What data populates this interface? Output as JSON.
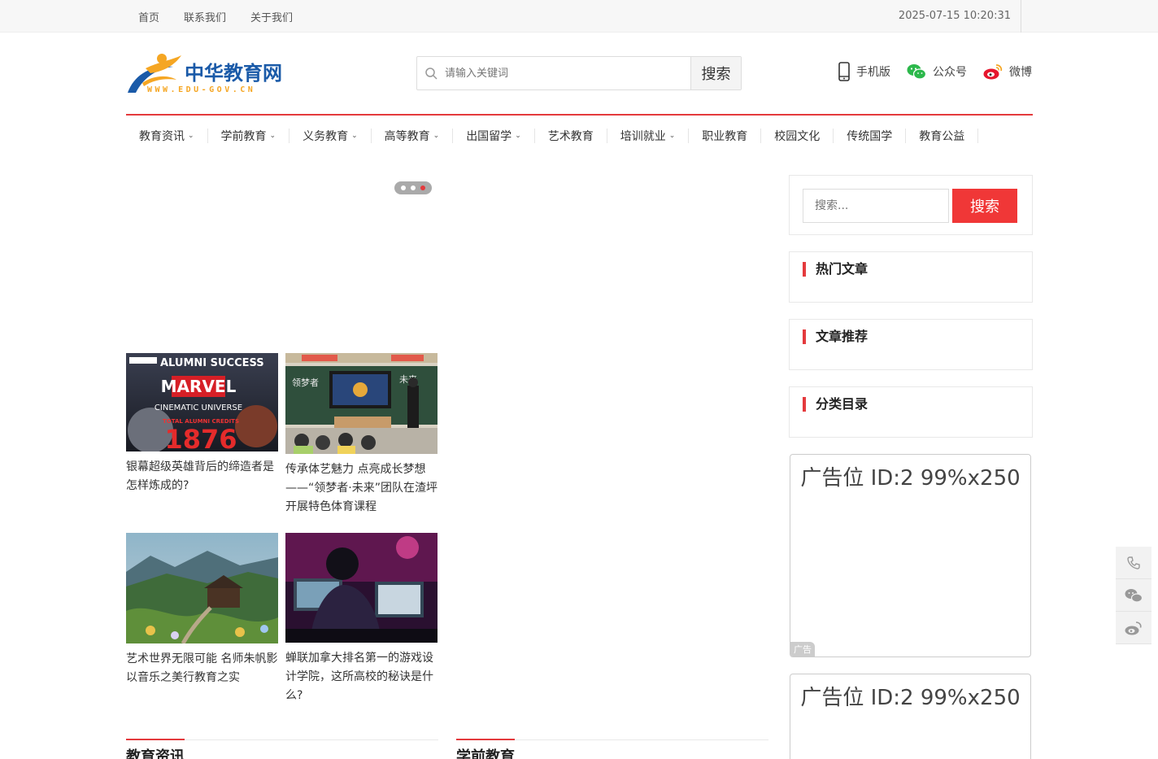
{
  "topbar": {
    "links": [
      "首页",
      "联系我们",
      "关于我们"
    ],
    "datetime": "2025-07-15 10:20:31"
  },
  "logo": {
    "text": "中华教育网",
    "subtext": "WWW.EDU-GOV.CN"
  },
  "search": {
    "placeholder": "请输入关键词",
    "button": "搜索"
  },
  "header_links": {
    "mobile": "手机版",
    "wechat": "公众号",
    "weibo": "微博"
  },
  "nav": {
    "items": [
      {
        "label": "教育资讯",
        "dropdown": true
      },
      {
        "label": "学前教育",
        "dropdown": true
      },
      {
        "label": "义务教育",
        "dropdown": true
      },
      {
        "label": "高等教育",
        "dropdown": true
      },
      {
        "label": "出国留学",
        "dropdown": true
      },
      {
        "label": "艺术教育",
        "dropdown": false
      },
      {
        "label": "培训就业",
        "dropdown": true
      },
      {
        "label": "职业教育",
        "dropdown": false
      },
      {
        "label": "校园文化",
        "dropdown": false
      },
      {
        "label": "传统国学",
        "dropdown": false
      },
      {
        "label": "教育公益",
        "dropdown": false
      }
    ]
  },
  "slider": {
    "dots": 3,
    "active": 3
  },
  "cards": [
    {
      "title": "银幕超级英雄背后的缔造者是怎样炼成的?",
      "thumb": {
        "line1": "ALUMNI SUCCESS",
        "line2": "MARVEL",
        "line3": "CINEMATIC UNIVERSE",
        "line4": "TOTAL ALUMNI CREDITS",
        "number": "1876"
      }
    },
    {
      "title": "传承体艺魅力 点亮成长梦想——“领梦者·未来”团队在渣坪开展特色体育课程",
      "thumb": {
        "board_left": "领梦者",
        "board_right": "未来"
      }
    },
    {
      "title": "艺术世界无限可能 名师朱帆影以音乐之美行教育之实",
      "thumb": {}
    },
    {
      "title": "蝉联加拿大排名第一的游戏设计学院，这所高校的秘诀是什么?",
      "thumb": {}
    }
  ],
  "sections": [
    "教育资讯",
    "学前教育"
  ],
  "sidebar": {
    "search_placeholder": "搜索...",
    "search_button": "搜索",
    "widgets": [
      "热门文章",
      "文章推荐",
      "分类目录"
    ],
    "ads": [
      {
        "text": "广告位 ID:2 99%x250",
        "tag": "广告"
      },
      {
        "text": "广告位 ID:2 99%x250",
        "tag": "广告"
      }
    ]
  }
}
